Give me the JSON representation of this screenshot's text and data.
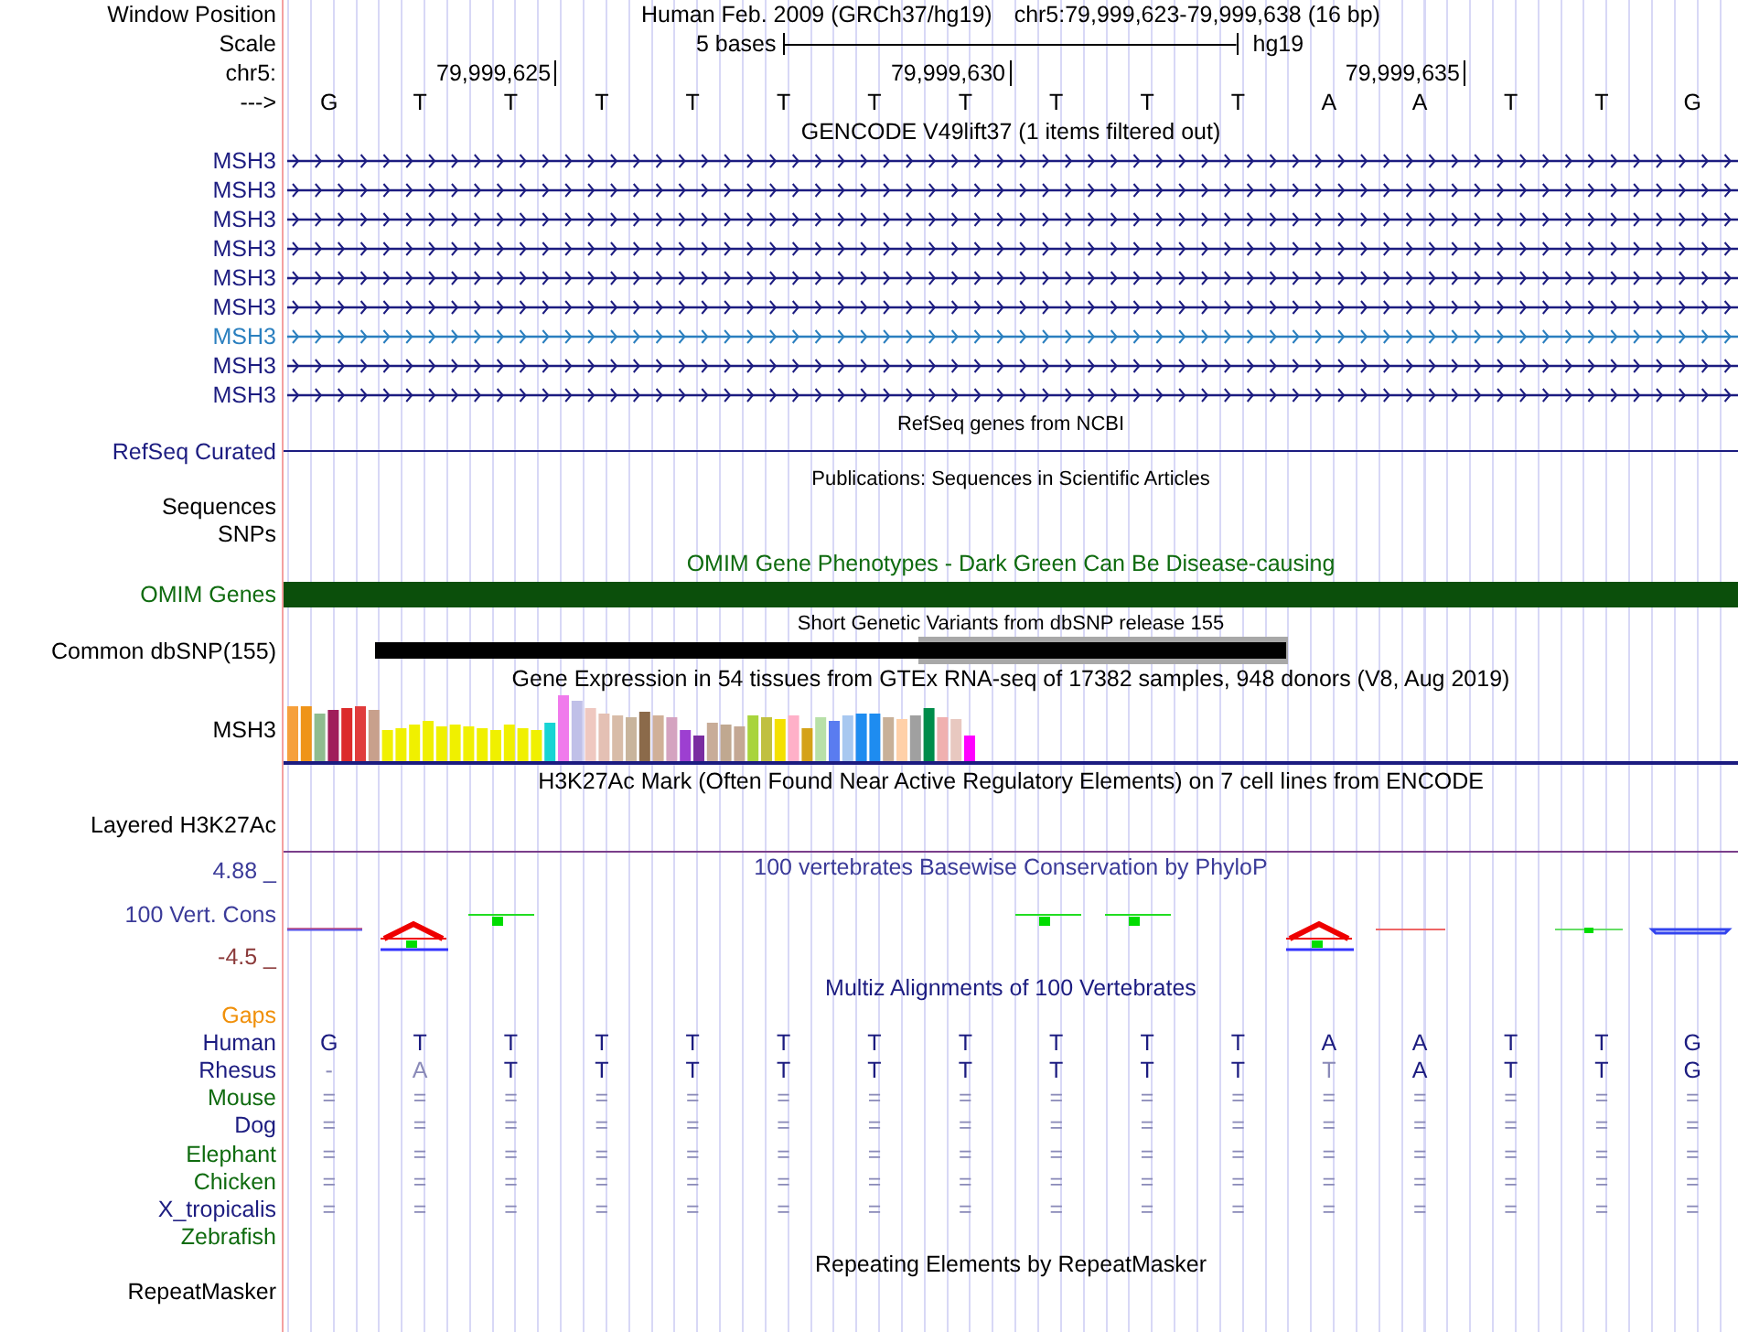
{
  "window_position": {
    "label": "Window Position",
    "assembly": "Human Feb. 2009 (GRCh37/hg19)",
    "range": "chr5:79,999,623-79,999,638 (16 bp)"
  },
  "scale": {
    "label": "Scale",
    "span": "5 bases",
    "assembly": "hg19"
  },
  "ruler": {
    "label": "chr5:",
    "ticks": [
      "79,999,625",
      "79,999,630",
      "79,999,635"
    ]
  },
  "sequence": {
    "label": "--->",
    "bases": [
      "G",
      "T",
      "T",
      "T",
      "T",
      "T",
      "T",
      "T",
      "T",
      "T",
      "T",
      "A",
      "A",
      "T",
      "T",
      "G"
    ]
  },
  "gencode": {
    "title": "GENCODE V49lift37 (1 items filtered out)",
    "transcripts": [
      {
        "name": "MSH3",
        "color": "#1c1c80"
      },
      {
        "name": "MSH3",
        "color": "#1c1c80"
      },
      {
        "name": "MSH3",
        "color": "#1c1c80"
      },
      {
        "name": "MSH3",
        "color": "#1c1c80"
      },
      {
        "name": "MSH3",
        "color": "#1c1c80"
      },
      {
        "name": "MSH3",
        "color": "#1c1c80"
      },
      {
        "name": "MSH3",
        "color": "#2a7fbf"
      },
      {
        "name": "MSH3",
        "color": "#1c1c80"
      },
      {
        "name": "MSH3",
        "color": "#1c1c80"
      }
    ]
  },
  "refseq": {
    "title": "RefSeq genes from NCBI",
    "label": "RefSeq Curated"
  },
  "publications": {
    "title": "Publications: Sequences in Scientific Articles",
    "labels": [
      "Sequences",
      "SNPs"
    ]
  },
  "omim": {
    "title": "OMIM Gene Phenotypes - Dark Green Can Be Disease-causing",
    "label": "OMIM Genes"
  },
  "dbsnp": {
    "title": "Short Genetic Variants from dbSNP release 155",
    "label": "Common dbSNP(155)"
  },
  "gtex": {
    "title": "Gene Expression in 54 tissues from GTEx RNA-seq of 17382 samples, 948 donors (V8, Aug 2019)",
    "label": "MSH3"
  },
  "h3k27ac": {
    "title": "H3K27Ac Mark (Often Found Near Active Regulatory Elements) on 7 cell lines from ENCODE",
    "label": "Layered H3K27Ac"
  },
  "conservation": {
    "title": "100 vertebrates Basewise Conservation by PhyloP",
    "label": "100 Vert. Cons",
    "max": "4.88 _",
    "min": "-4.5 _"
  },
  "multiz": {
    "title": "Multiz Alignments of 100 Vertebrates",
    "gaps_label": "Gaps",
    "species": [
      {
        "name": "Human",
        "color": "#1c1c80",
        "bases": [
          "G",
          "T",
          "T",
          "T",
          "T",
          "T",
          "T",
          "T",
          "T",
          "T",
          "T",
          "A",
          "A",
          "T",
          "T",
          "G"
        ]
      },
      {
        "name": "Rhesus",
        "color": "#1c1c80",
        "bases": [
          "-",
          "A",
          "T",
          "T",
          "T",
          "T",
          "T",
          "T",
          "T",
          "T",
          "T",
          "T",
          "A",
          "T",
          "T",
          "G"
        ]
      },
      {
        "name": "Mouse",
        "color": "#0f6b0f",
        "bases": [
          "=",
          "=",
          "=",
          "=",
          "=",
          "=",
          "=",
          "=",
          "=",
          "=",
          "=",
          "=",
          "=",
          "=",
          "=",
          "="
        ]
      },
      {
        "name": "Dog",
        "color": "#1c1c80",
        "bases": [
          "=",
          "=",
          "=",
          "=",
          "=",
          "=",
          "=",
          "=",
          "=",
          "=",
          "=",
          "=",
          "=",
          "=",
          "=",
          "="
        ]
      },
      {
        "name": "Elephant",
        "color": "#0f6b0f",
        "bases": [
          "=",
          "=",
          "=",
          "=",
          "=",
          "=",
          "=",
          "=",
          "=",
          "=",
          "=",
          "=",
          "=",
          "=",
          "=",
          "="
        ]
      },
      {
        "name": "Chicken",
        "color": "#0f6b0f",
        "bases": [
          "=",
          "=",
          "=",
          "=",
          "=",
          "=",
          "=",
          "=",
          "=",
          "=",
          "=",
          "=",
          "=",
          "=",
          "=",
          "="
        ]
      },
      {
        "name": "X_tropicalis",
        "color": "#1c1c80",
        "bases": [
          "=",
          "=",
          "=",
          "=",
          "=",
          "=",
          "=",
          "=",
          "=",
          "=",
          "=",
          "=",
          "=",
          "=",
          "=",
          "="
        ]
      },
      {
        "name": "Zebrafish",
        "color": "#0f6b0f"
      }
    ]
  },
  "repeatmasker": {
    "title": "Repeating Elements by RepeatMasker",
    "label": "RepeatMasker"
  }
}
